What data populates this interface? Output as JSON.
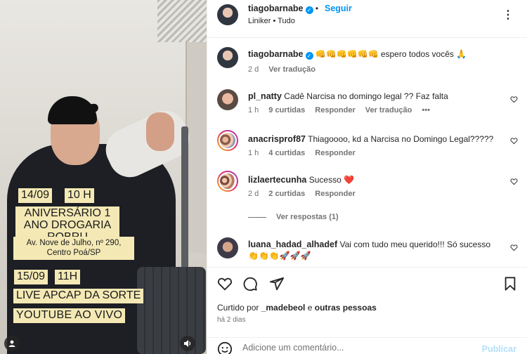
{
  "media": {
    "stickers": {
      "date1": "14/09",
      "time1": "10 H",
      "event1": "ANIVERSÁRIO 1 ANO DROGARIA ROBRU",
      "address": "Av. Nove de Julho, nº 290, Centro Poá/SP",
      "date2": "15/09",
      "time2": "11H",
      "event2": "LIVE APCAP DA SORTE",
      "channel": "YOUTUBE    AO VIVO"
    },
    "icons": {
      "user_tag": "user-tag-icon",
      "mute": "speaker-icon"
    }
  },
  "header": {
    "username": "tiagobarnabe",
    "follow_label": "Seguir",
    "separator": "•",
    "audio": "Liniker • Tudo",
    "more_icon": "more-options-icon"
  },
  "caption": {
    "username": "tiagobarnabe",
    "text": "👊👊👊👊👊👊 espero todos vocês 🙏",
    "time": "2 d",
    "translate": "Ver tradução"
  },
  "comments": [
    {
      "username": "pl_natty",
      "text": "Cadê Narcisa no domingo legal ?? Faz falta",
      "time": "1 h",
      "likes": "9 curtidas",
      "reply": "Responder",
      "translate": "Ver tradução",
      "more": "•••"
    },
    {
      "username": "anacrisprof87",
      "text": "Thiagoooo, kd a Narcisa no Domingo Legal?????",
      "time": "1 h",
      "likes": "4 curtidas",
      "reply": "Responder"
    },
    {
      "username": "lizlaertecunha",
      "text": "Sucesso ❤️",
      "time": "2 d",
      "likes": "2 curtidas",
      "reply": "Responder",
      "replies": "Ver respostas (1)"
    },
    {
      "username": "luana_hadad_alhadef",
      "text": "Vai com tudo meu querido!!! Só sucesso 👏👏👏🚀🚀🚀"
    }
  ],
  "actions": {
    "liked_prefix": "Curtido por ",
    "liked_user": "_madebeol",
    "liked_mid": " e ",
    "liked_others": "outras pessoas",
    "ago": "há 2 dias"
  },
  "add_comment": {
    "placeholder": "Adicione um comentário...",
    "post_label": "Publicar"
  },
  "colors": {
    "accent": "#0095f6",
    "sticker": "#f4e9b5",
    "muted_text": "#737373"
  }
}
